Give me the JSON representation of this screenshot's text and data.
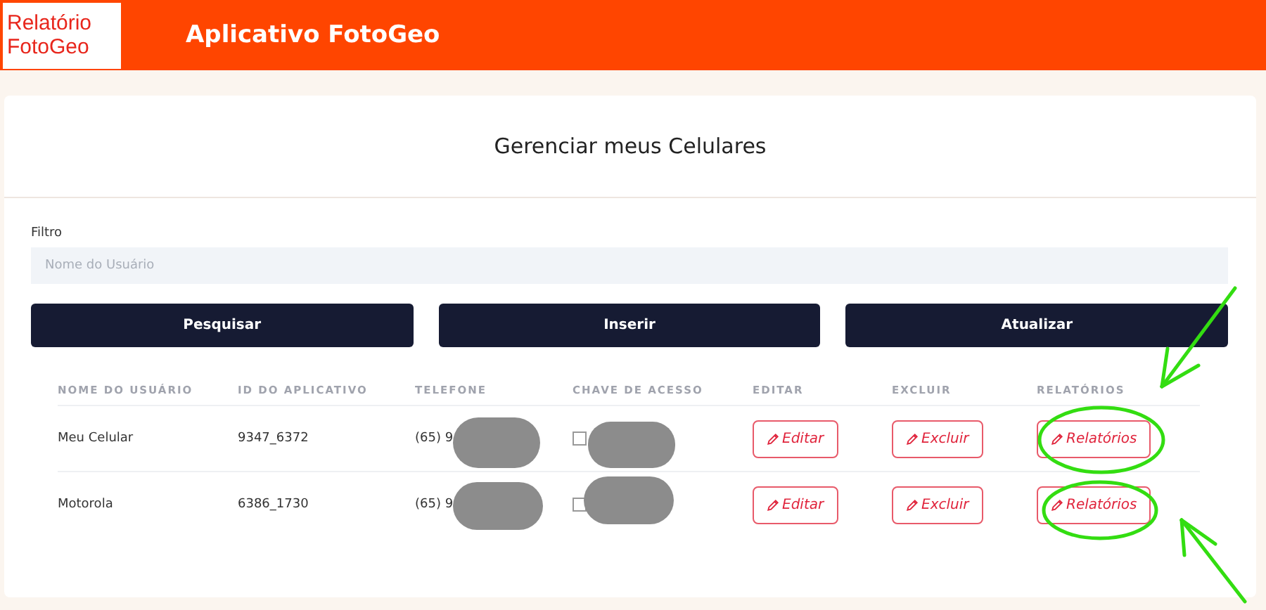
{
  "header": {
    "logo_line_1": "Relatório",
    "logo_line_2": "FotoGeo",
    "title": "Aplicativo FotoGeo"
  },
  "page_title": "Gerenciar meus Celulares",
  "filter": {
    "label": "Filtro",
    "placeholder": "Nome do Usuário"
  },
  "buttons": [
    "Pesquisar",
    "Inserir",
    "Atualizar"
  ],
  "table": {
    "columns": [
      "NOME DO USUÁRIO",
      "ID DO APLICATIVO",
      "TELEFONE",
      "CHAVE DE ACESSO",
      "EDITAR",
      "EXCLUIR",
      "RELATÓRIOS"
    ],
    "rows": [
      {
        "name": "Meu Celular",
        "app_id": "9347_6372",
        "phone": "(65) 9",
        "key_checked": false,
        "edit": "Editar",
        "delete": "Excluir",
        "reports": "Relatórios"
      },
      {
        "name": "Motorola",
        "app_id": "6386_1730",
        "phone": "(65) 9",
        "key_checked": false,
        "edit": "Editar",
        "delete": "Excluir",
        "reports": "Relatórios"
      }
    ]
  }
}
